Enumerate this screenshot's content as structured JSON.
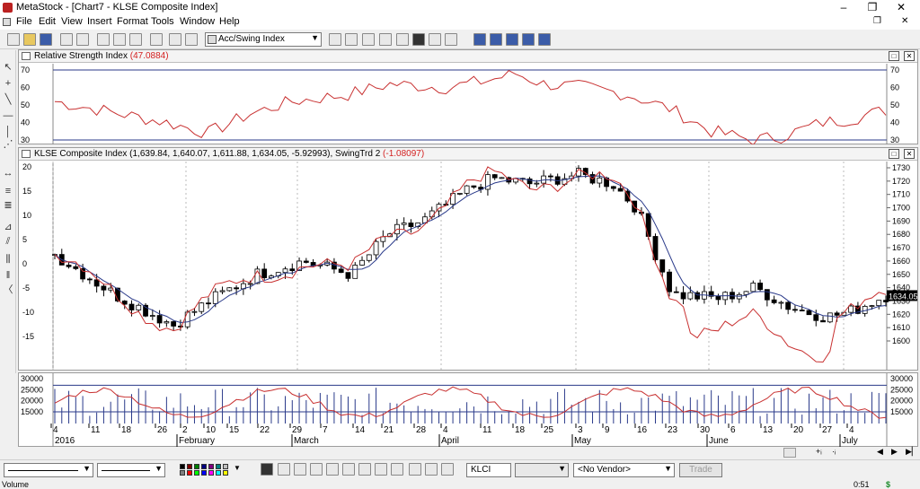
{
  "window": {
    "app_name": "MetaStock",
    "title": "MetaStock - [Chart7 - KLSE Composite Index]",
    "minimize": "–",
    "restore": "❐",
    "close": "✕",
    "child_close": "✕",
    "child_restore": "❐"
  },
  "menu": [
    "File",
    "Edit",
    "View",
    "Insert",
    "Format",
    "Tools",
    "Window",
    "Help"
  ],
  "toolbar": {
    "indicator_select": "Acc/Swing Index"
  },
  "rsi_pane": {
    "label": "Relative Strength Index",
    "value": "(47.0884)",
    "y_ticks": [
      "70",
      "60",
      "50",
      "40",
      "30"
    ],
    "overbought": 70,
    "oversold": 30,
    "color": "#c83030"
  },
  "price_pane": {
    "label": "KLSE Composite Index (1,639.84, 1,640.07, 1,611.88, 1,634.05, -5.92993), SwingTrd 2",
    "swing_value": "(-1.08097)",
    "left_ticks": [
      "20",
      "15",
      "10",
      "5",
      "0",
      "-5",
      "-10",
      "-15"
    ],
    "right_ticks": [
      "1730",
      "1720",
      "1710",
      "1700",
      "1690",
      "1680",
      "1670",
      "1660",
      "1650",
      "1640",
      "1630",
      "1620",
      "1610",
      "1600"
    ],
    "last_price": "1634.050",
    "ma_color": "#2a3a8a",
    "swing_color": "#c83030"
  },
  "volume_pane": {
    "ticks": [
      "30000",
      "25000",
      "20000",
      "15000"
    ],
    "bar_color": "#2a3a8a",
    "line_color": "#c83030"
  },
  "date_axis": {
    "days": [
      "4",
      "11",
      "18",
      "26",
      "2",
      "10",
      "15",
      "22",
      "29",
      "7",
      "14",
      "21",
      "28",
      "4",
      "11",
      "18",
      "25",
      "3",
      "9",
      "16",
      "23",
      "30",
      "6",
      "13",
      "20",
      "27",
      "4"
    ],
    "year": "2016",
    "months": [
      "February",
      "March",
      "April",
      "May",
      "June",
      "July"
    ]
  },
  "bottombar": {
    "symbol": "KLCI",
    "vendor": "<No Vendor>",
    "trade": "Trade"
  },
  "statusbar": {
    "left": "Volume",
    "time": "0:51",
    "money": "$"
  }
}
